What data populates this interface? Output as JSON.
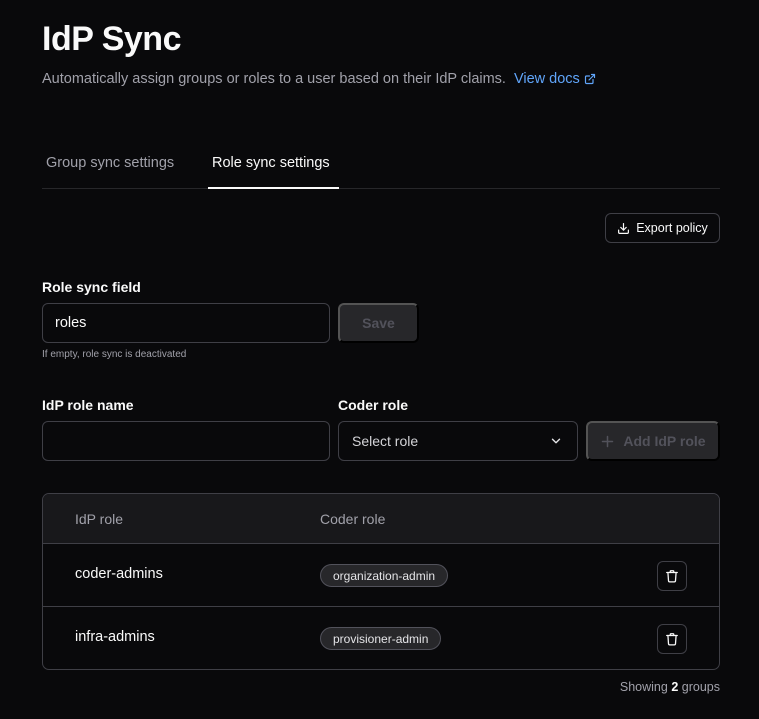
{
  "header": {
    "title": "IdP Sync",
    "subtitle": "Automatically assign groups or roles to a user based on their IdP claims.",
    "docs_link": "View docs"
  },
  "tabs": [
    {
      "label": "Group sync settings",
      "active": false
    },
    {
      "label": "Role sync settings",
      "active": true
    }
  ],
  "toolbar": {
    "export_label": "Export policy"
  },
  "role_sync_field": {
    "label": "Role sync field",
    "value": "roles",
    "save_label": "Save",
    "helper": "If empty, role sync is deactivated"
  },
  "mapping_form": {
    "idp_role_label": "IdP role name",
    "idp_role_value": "",
    "coder_role_label": "Coder role",
    "coder_role_placeholder": "Select role",
    "add_label": "Add IdP role"
  },
  "table": {
    "columns": [
      "IdP role",
      "Coder role"
    ],
    "rows": [
      {
        "idp_role": "coder-admins",
        "coder_role": "organization-admin"
      },
      {
        "idp_role": "infra-admins",
        "coder_role": "provisioner-admin"
      }
    ]
  },
  "footer": {
    "prefix": "Showing",
    "count": "2",
    "suffix": "groups"
  },
  "colors": {
    "background": "#09090b",
    "link": "#60a5fa",
    "border": "#3f3f46"
  },
  "icons": [
    "external-link-icon",
    "download-icon",
    "plus-icon",
    "chevron-down-icon",
    "trash-icon"
  ]
}
